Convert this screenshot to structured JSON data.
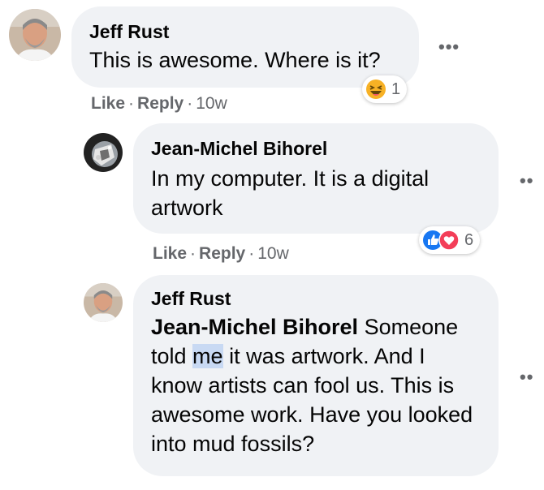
{
  "comments": [
    {
      "author": "Jeff Rust",
      "text": "This is awesome. Where is it?",
      "actions": {
        "like": "Like",
        "reply": "Reply",
        "sep": "·",
        "time": "10w"
      },
      "reactions": {
        "icons": [
          "haha-icon"
        ],
        "count": "1"
      },
      "more": "•••"
    },
    {
      "author": "Jean-Michel Bihorel",
      "text": "In my computer. It is a digital artwork",
      "actions": {
        "like": "Like",
        "reply": "Reply",
        "sep": "·",
        "time": "10w"
      },
      "reactions": {
        "icons": [
          "like-icon",
          "love-icon"
        ],
        "count": "6"
      },
      "more": "••"
    },
    {
      "author": "Jeff Rust",
      "mention": "Jean-Michel Bihorel",
      "text_before": " Someone told ",
      "highlight": "me",
      "text_after": " it was artwork. And I know artists can fool us. This is awesome work. Have you looked into mud fossils?",
      "more": "••"
    }
  ],
  "colors": {
    "bubble": "#f0f2f5",
    "meta": "#65676b",
    "like_blue": "#1877f2",
    "love_red": "#f33e58",
    "haha_yellow": "#f7b125",
    "highlight": "#c8d9f3"
  }
}
